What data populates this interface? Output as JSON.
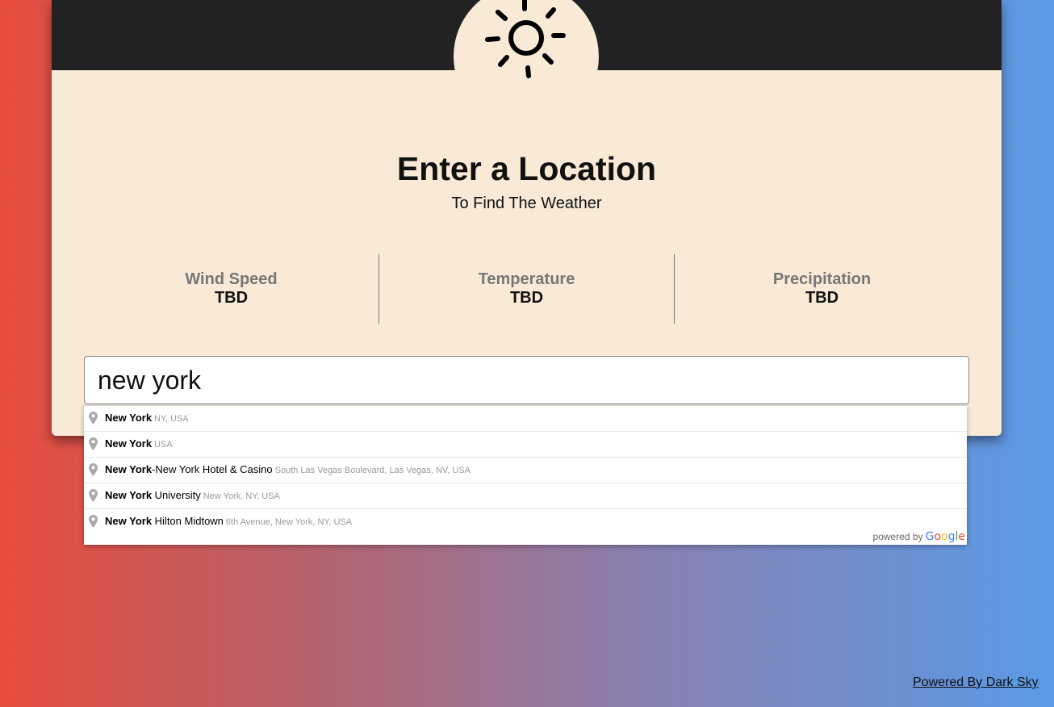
{
  "header": {
    "icon": "sun-icon"
  },
  "heading": {
    "title": "Enter a Location",
    "subtitle": "To Find The Weather"
  },
  "stats": [
    {
      "label": "Wind Speed",
      "value": "TBD"
    },
    {
      "label": "Temperature",
      "value": "TBD"
    },
    {
      "label": "Precipitation",
      "value": "TBD"
    }
  ],
  "search": {
    "value": "new york"
  },
  "suggestions": [
    {
      "match": "New York",
      "rest": "",
      "secondary": "NY, USA"
    },
    {
      "match": "New York",
      "rest": "",
      "secondary": "USA"
    },
    {
      "match": "New York",
      "rest": "-New York Hotel & Casino",
      "secondary": "South Las Vegas Boulevard, Las Vegas, NV, USA"
    },
    {
      "match": "New York",
      "rest": " University",
      "secondary": "New York, NY, USA"
    },
    {
      "match": "New York",
      "rest": " Hilton Midtown",
      "secondary": "6th Avenue, New York, NY, USA"
    }
  ],
  "powered_by": {
    "text": "powered by",
    "brand": "Google"
  },
  "footer": {
    "link": "Powered By Dark Sky"
  },
  "colors": {
    "gradient_left": "#e74c3c",
    "gradient_right": "#5a9ae6",
    "card": "#f8ead7",
    "header": "#222222"
  }
}
